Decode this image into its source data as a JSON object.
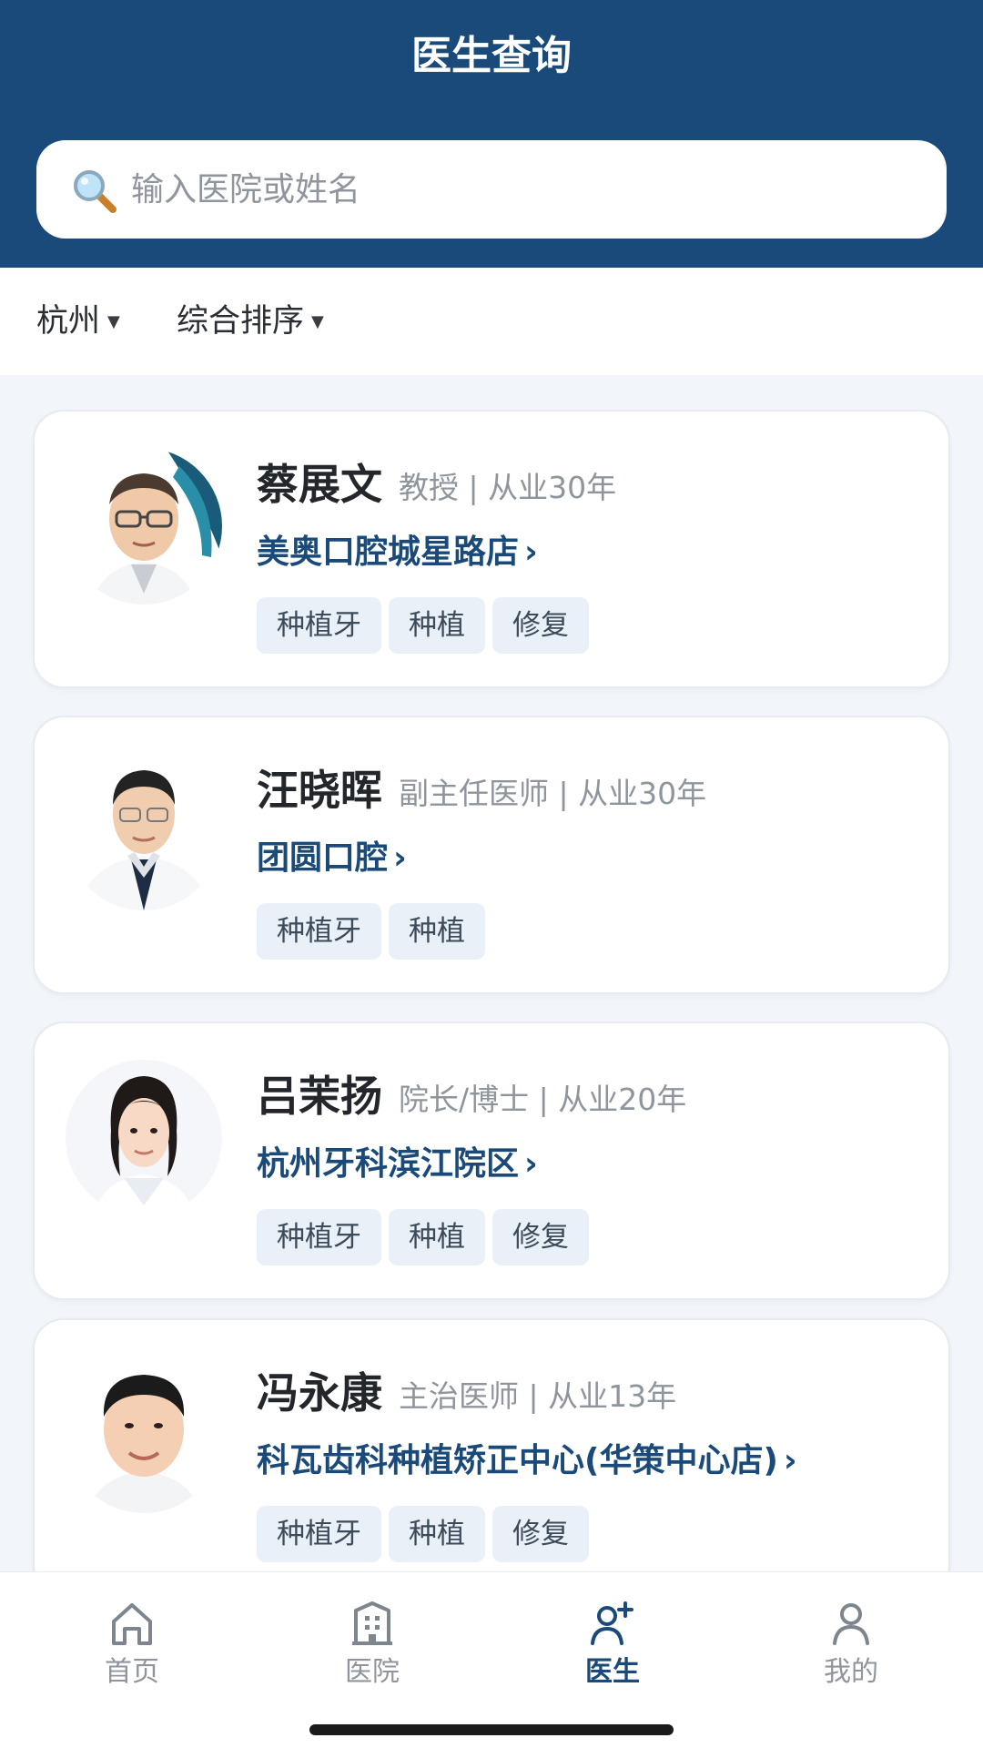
{
  "header": {
    "title": "医生查询"
  },
  "search": {
    "placeholder": "输入医院或姓名",
    "icon": "magnifier-icon"
  },
  "filters": [
    {
      "label": "杭州",
      "icon": "caret-down-icon"
    },
    {
      "label": "综合排序",
      "icon": "caret-down-icon"
    }
  ],
  "doctors": [
    {
      "name": "蔡展文",
      "meta": "教授 | 从业30年",
      "hospital": "美奥口腔城星路店",
      "chevron": "›",
      "tags": [
        "种植牙",
        "种植",
        "修复"
      ]
    },
    {
      "name": "汪晓晖",
      "meta": "副主任医师 | 从业30年",
      "hospital": "团圆口腔",
      "chevron": "›",
      "tags": [
        "种植牙",
        "种植"
      ]
    },
    {
      "name": "吕茉扬",
      "meta": "院长/博士 | 从业20年",
      "hospital": "杭州牙科滨江院区",
      "chevron": "›",
      "tags": [
        "种植牙",
        "种植",
        "修复"
      ]
    },
    {
      "name": "冯永康",
      "meta": "主治医师 | 从业13年",
      "hospital": "科瓦齿科种植矫正中心(华策中心店)",
      "chevron": "›",
      "tags": [
        "种植牙",
        "种植",
        "修复"
      ]
    }
  ],
  "nav": [
    {
      "label": "首页",
      "icon": "home-icon",
      "active": false
    },
    {
      "label": "医院",
      "icon": "hospital-icon",
      "active": false
    },
    {
      "label": "医生",
      "icon": "doctor-add-icon",
      "active": true
    },
    {
      "label": "我的",
      "icon": "user-icon",
      "active": false
    }
  ],
  "colors": {
    "primary": "#1a4a79",
    "tag_bg": "#e9f0f7",
    "muted_text": "#8f959c",
    "page_bg": "#f2f5f9"
  }
}
